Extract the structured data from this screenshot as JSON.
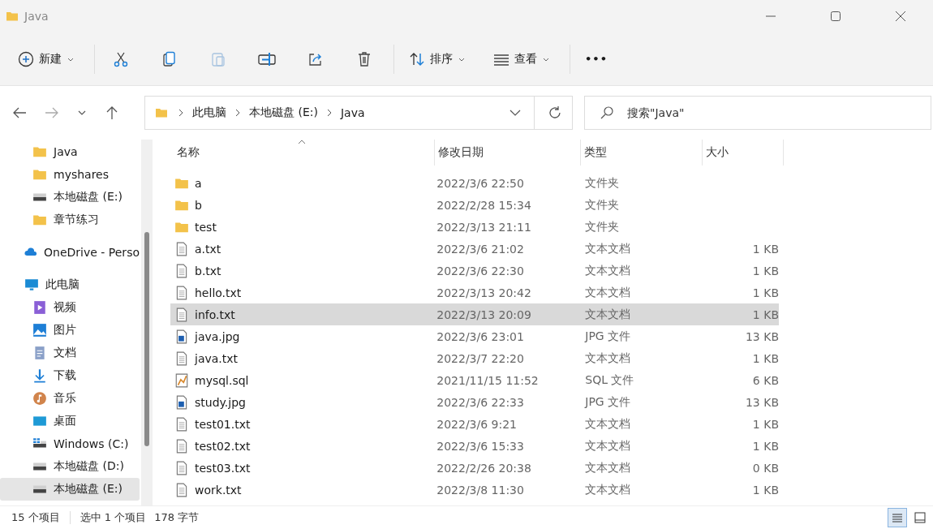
{
  "window": {
    "title": "Java"
  },
  "toolbar": {
    "new_label": "新建",
    "sort_label": "排序",
    "view_label": "查看",
    "more": "•••"
  },
  "address": {
    "segments": [
      "此电脑",
      "本地磁盘 (E:)",
      "Java"
    ],
    "search_placeholder": "搜索\"Java\""
  },
  "sidebar": {
    "quick_access": [
      {
        "label": "Java",
        "kind": "folder",
        "selected": false
      },
      {
        "label": "myshares",
        "kind": "folder",
        "selected": false
      },
      {
        "label": "本地磁盘 (E:)",
        "kind": "drive",
        "selected": false
      },
      {
        "label": "章节练习",
        "kind": "folder",
        "selected": false
      }
    ],
    "items": [
      {
        "label": "OneDrive - Perso",
        "kind": "cloud",
        "selected": false
      },
      {
        "label": "此电脑",
        "kind": "pc",
        "selected": false,
        "children": [
          {
            "label": "视频",
            "kind": "video",
            "selected": false
          },
          {
            "label": "图片",
            "kind": "picture",
            "selected": false
          },
          {
            "label": "文档",
            "kind": "doc",
            "selected": false
          },
          {
            "label": "下载",
            "kind": "download",
            "selected": false
          },
          {
            "label": "音乐",
            "kind": "music",
            "selected": false
          },
          {
            "label": "桌面",
            "kind": "desktop",
            "selected": false
          },
          {
            "label": "Windows (C:)",
            "kind": "windrive",
            "selected": false
          },
          {
            "label": "本地磁盘 (D:)",
            "kind": "drive",
            "selected": false
          },
          {
            "label": "本地磁盘 (E:)",
            "kind": "drive",
            "selected": true
          }
        ]
      }
    ]
  },
  "table": {
    "columns": [
      "名称",
      "修改日期",
      "类型",
      "大小"
    ],
    "rows": [
      {
        "name": "a",
        "kind": "folder",
        "date": "2022/3/6 22:50",
        "type": "文件夹",
        "size": "",
        "selected": false
      },
      {
        "name": "b",
        "kind": "folder",
        "date": "2022/2/28 15:34",
        "type": "文件夹",
        "size": "",
        "selected": false
      },
      {
        "name": "test",
        "kind": "folder",
        "date": "2022/3/13 21:11",
        "type": "文件夹",
        "size": "",
        "selected": false
      },
      {
        "name": "a.txt",
        "kind": "text",
        "date": "2022/3/6 21:02",
        "type": "文本文档",
        "size": "1 KB",
        "selected": false
      },
      {
        "name": "b.txt",
        "kind": "text",
        "date": "2022/3/6 22:30",
        "type": "文本文档",
        "size": "1 KB",
        "selected": false
      },
      {
        "name": "hello.txt",
        "kind": "text",
        "date": "2022/3/13 20:42",
        "type": "文本文档",
        "size": "1 KB",
        "selected": false
      },
      {
        "name": "info.txt",
        "kind": "text",
        "date": "2022/3/13 20:09",
        "type": "文本文档",
        "size": "1 KB",
        "selected": true
      },
      {
        "name": "java.jpg",
        "kind": "image",
        "date": "2022/3/6 23:01",
        "type": "JPG 文件",
        "size": "13 KB",
        "selected": false
      },
      {
        "name": "java.txt",
        "kind": "text",
        "date": "2022/3/7 22:20",
        "type": "文本文档",
        "size": "1 KB",
        "selected": false
      },
      {
        "name": "mysql.sql",
        "kind": "sql",
        "date": "2021/11/15 11:52",
        "type": "SQL 文件",
        "size": "6 KB",
        "selected": false
      },
      {
        "name": "study.jpg",
        "kind": "image",
        "date": "2022/3/6 22:33",
        "type": "JPG 文件",
        "size": "13 KB",
        "selected": false
      },
      {
        "name": "test01.txt",
        "kind": "text",
        "date": "2022/3/6 9:21",
        "type": "文本文档",
        "size": "1 KB",
        "selected": false
      },
      {
        "name": "test02.txt",
        "kind": "text",
        "date": "2022/3/6 15:33",
        "type": "文本文档",
        "size": "1 KB",
        "selected": false
      },
      {
        "name": "test03.txt",
        "kind": "text",
        "date": "2022/2/26 20:38",
        "type": "文本文档",
        "size": "0 KB",
        "selected": false
      },
      {
        "name": "work.txt",
        "kind": "text",
        "date": "2022/3/8 11:30",
        "type": "文本文档",
        "size": "1 KB",
        "selected": false
      }
    ]
  },
  "status_bar": {
    "count": "15 个项目",
    "selection": "选中 1 个项目",
    "size": "178 字节",
    "details_view": true
  }
}
